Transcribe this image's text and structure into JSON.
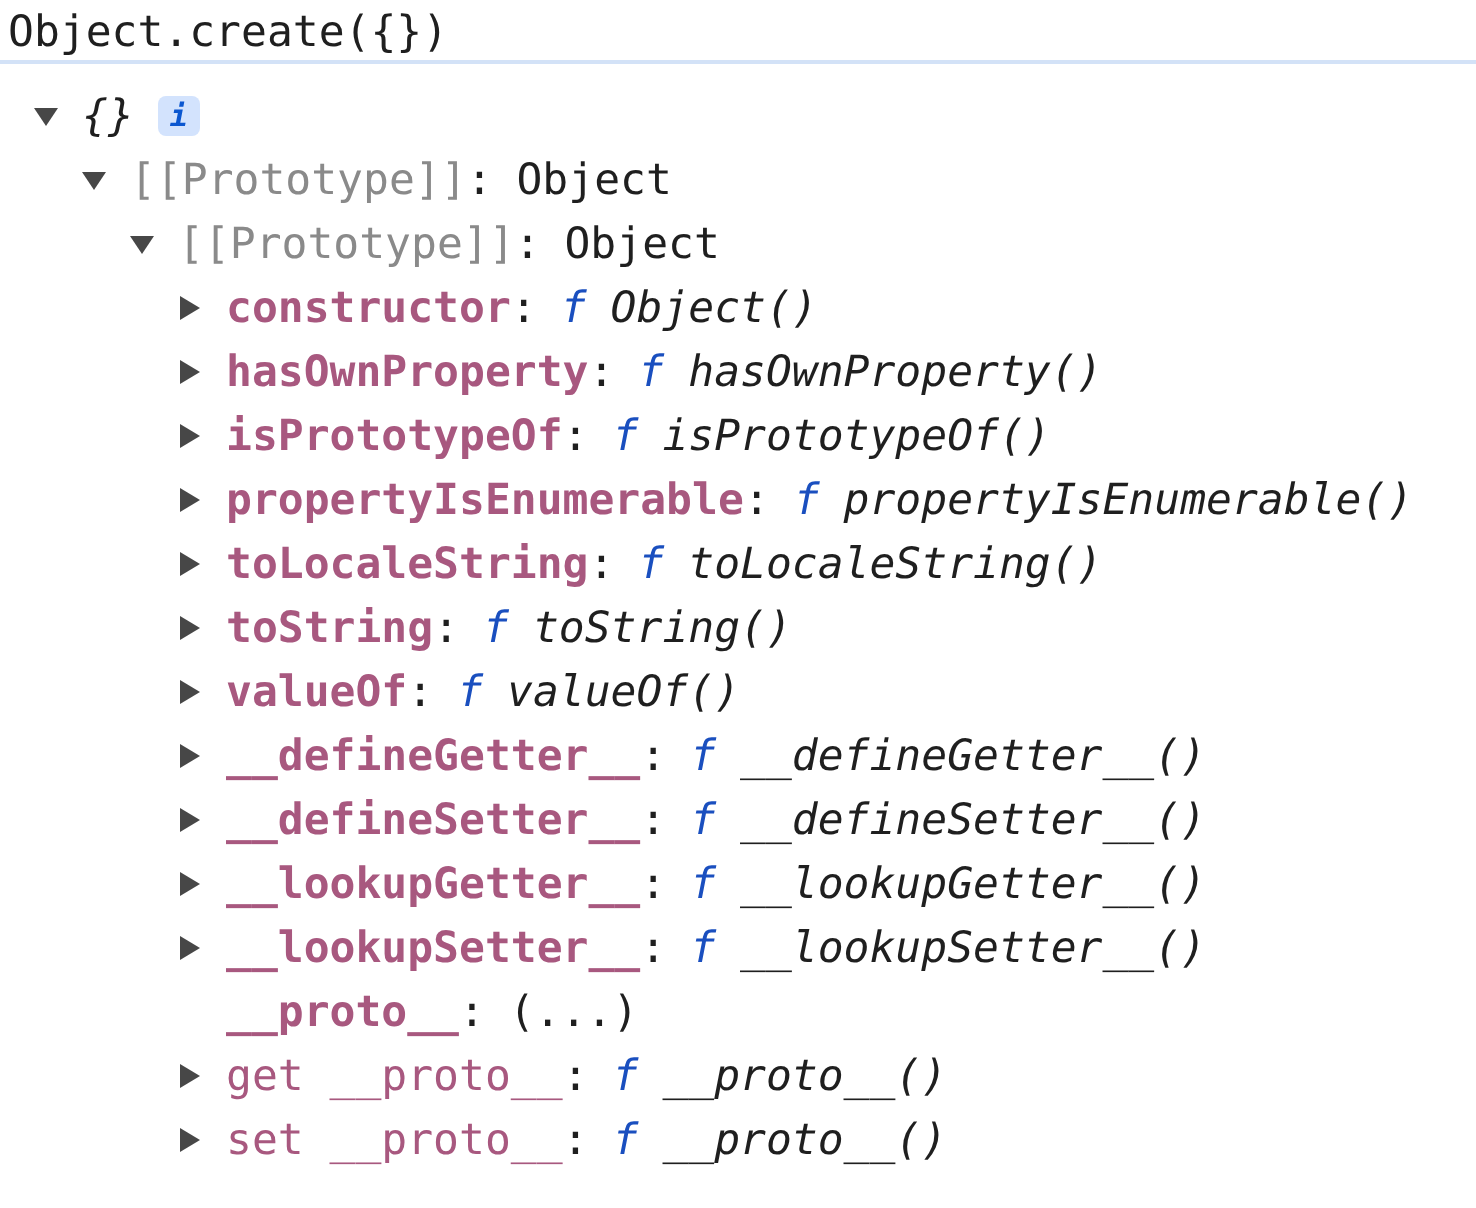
{
  "command": "Object.create({})",
  "tree": {
    "label": "{}",
    "badge": "i",
    "expanded": true,
    "children": [
      {
        "key": "[[Prototype]]",
        "sep": ":",
        "kind": "internal",
        "value": "Object",
        "expanded": true,
        "children": [
          {
            "key": "[[Prototype]]",
            "sep": ":",
            "kind": "internal",
            "value": "Object",
            "expanded": true,
            "children": [
              {
                "key": "constructor",
                "sep": ":",
                "kind": "own",
                "fn": "f",
                "value": "Object()",
                "expanded": false
              },
              {
                "key": "hasOwnProperty",
                "sep": ":",
                "kind": "own",
                "fn": "f",
                "value": "hasOwnProperty()",
                "expanded": false
              },
              {
                "key": "isPrototypeOf",
                "sep": ":",
                "kind": "own",
                "fn": "f",
                "value": "isPrototypeOf()",
                "expanded": false
              },
              {
                "key": "propertyIsEnumerable",
                "sep": ":",
                "kind": "own",
                "fn": "f",
                "value": "propertyIsEnumerable()",
                "expanded": false
              },
              {
                "key": "toLocaleString",
                "sep": ":",
                "kind": "own",
                "fn": "f",
                "value": "toLocaleString()",
                "expanded": false
              },
              {
                "key": "toString",
                "sep": ":",
                "kind": "own",
                "fn": "f",
                "value": "toString()",
                "expanded": false
              },
              {
                "key": "valueOf",
                "sep": ":",
                "kind": "own",
                "fn": "f",
                "value": "valueOf()",
                "expanded": false
              },
              {
                "key": "__defineGetter__",
                "sep": ":",
                "kind": "own",
                "fn": "f",
                "value": "__defineGetter__()",
                "expanded": false
              },
              {
                "key": "__defineSetter__",
                "sep": ":",
                "kind": "own",
                "fn": "f",
                "value": "__defineSetter__()",
                "expanded": false
              },
              {
                "key": "__lookupGetter__",
                "sep": ":",
                "kind": "own",
                "fn": "f",
                "value": "__lookupGetter__()",
                "expanded": false
              },
              {
                "key": "__lookupSetter__",
                "sep": ":",
                "kind": "own",
                "fn": "f",
                "value": "__lookupSetter__()",
                "expanded": false
              },
              {
                "key": "__proto__",
                "sep": ":",
                "kind": "own",
                "value": "(...)"
              },
              {
                "key": "get __proto__",
                "sep": ":",
                "kind": "accessor",
                "fn": "f",
                "value": "__proto__()",
                "expanded": false
              },
              {
                "key": "set __proto__",
                "sep": ":",
                "kind": "accessor",
                "fn": "f",
                "value": "__proto__()",
                "expanded": false
              }
            ]
          }
        ]
      }
    ]
  }
}
